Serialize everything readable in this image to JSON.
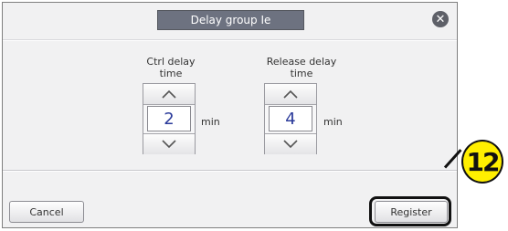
{
  "dialog": {
    "title": "Delay group Ie",
    "close_icon": "close-icon",
    "colors": {
      "title_bar": "#6d7280",
      "value_text": "#2a3a9a",
      "callout": "#ffef00"
    }
  },
  "ctrl_delay": {
    "label": "Ctrl delay\ntime",
    "value": "2",
    "unit": "min",
    "up_icon": "chevron-up-icon",
    "down_icon": "chevron-down-icon"
  },
  "release_delay": {
    "label": "Release delay\ntime",
    "value": "4",
    "unit": "min",
    "up_icon": "chevron-up-icon",
    "down_icon": "chevron-down-icon"
  },
  "footer": {
    "cancel_label": "Cancel",
    "register_label": "Register"
  },
  "callout": {
    "number": "12"
  }
}
